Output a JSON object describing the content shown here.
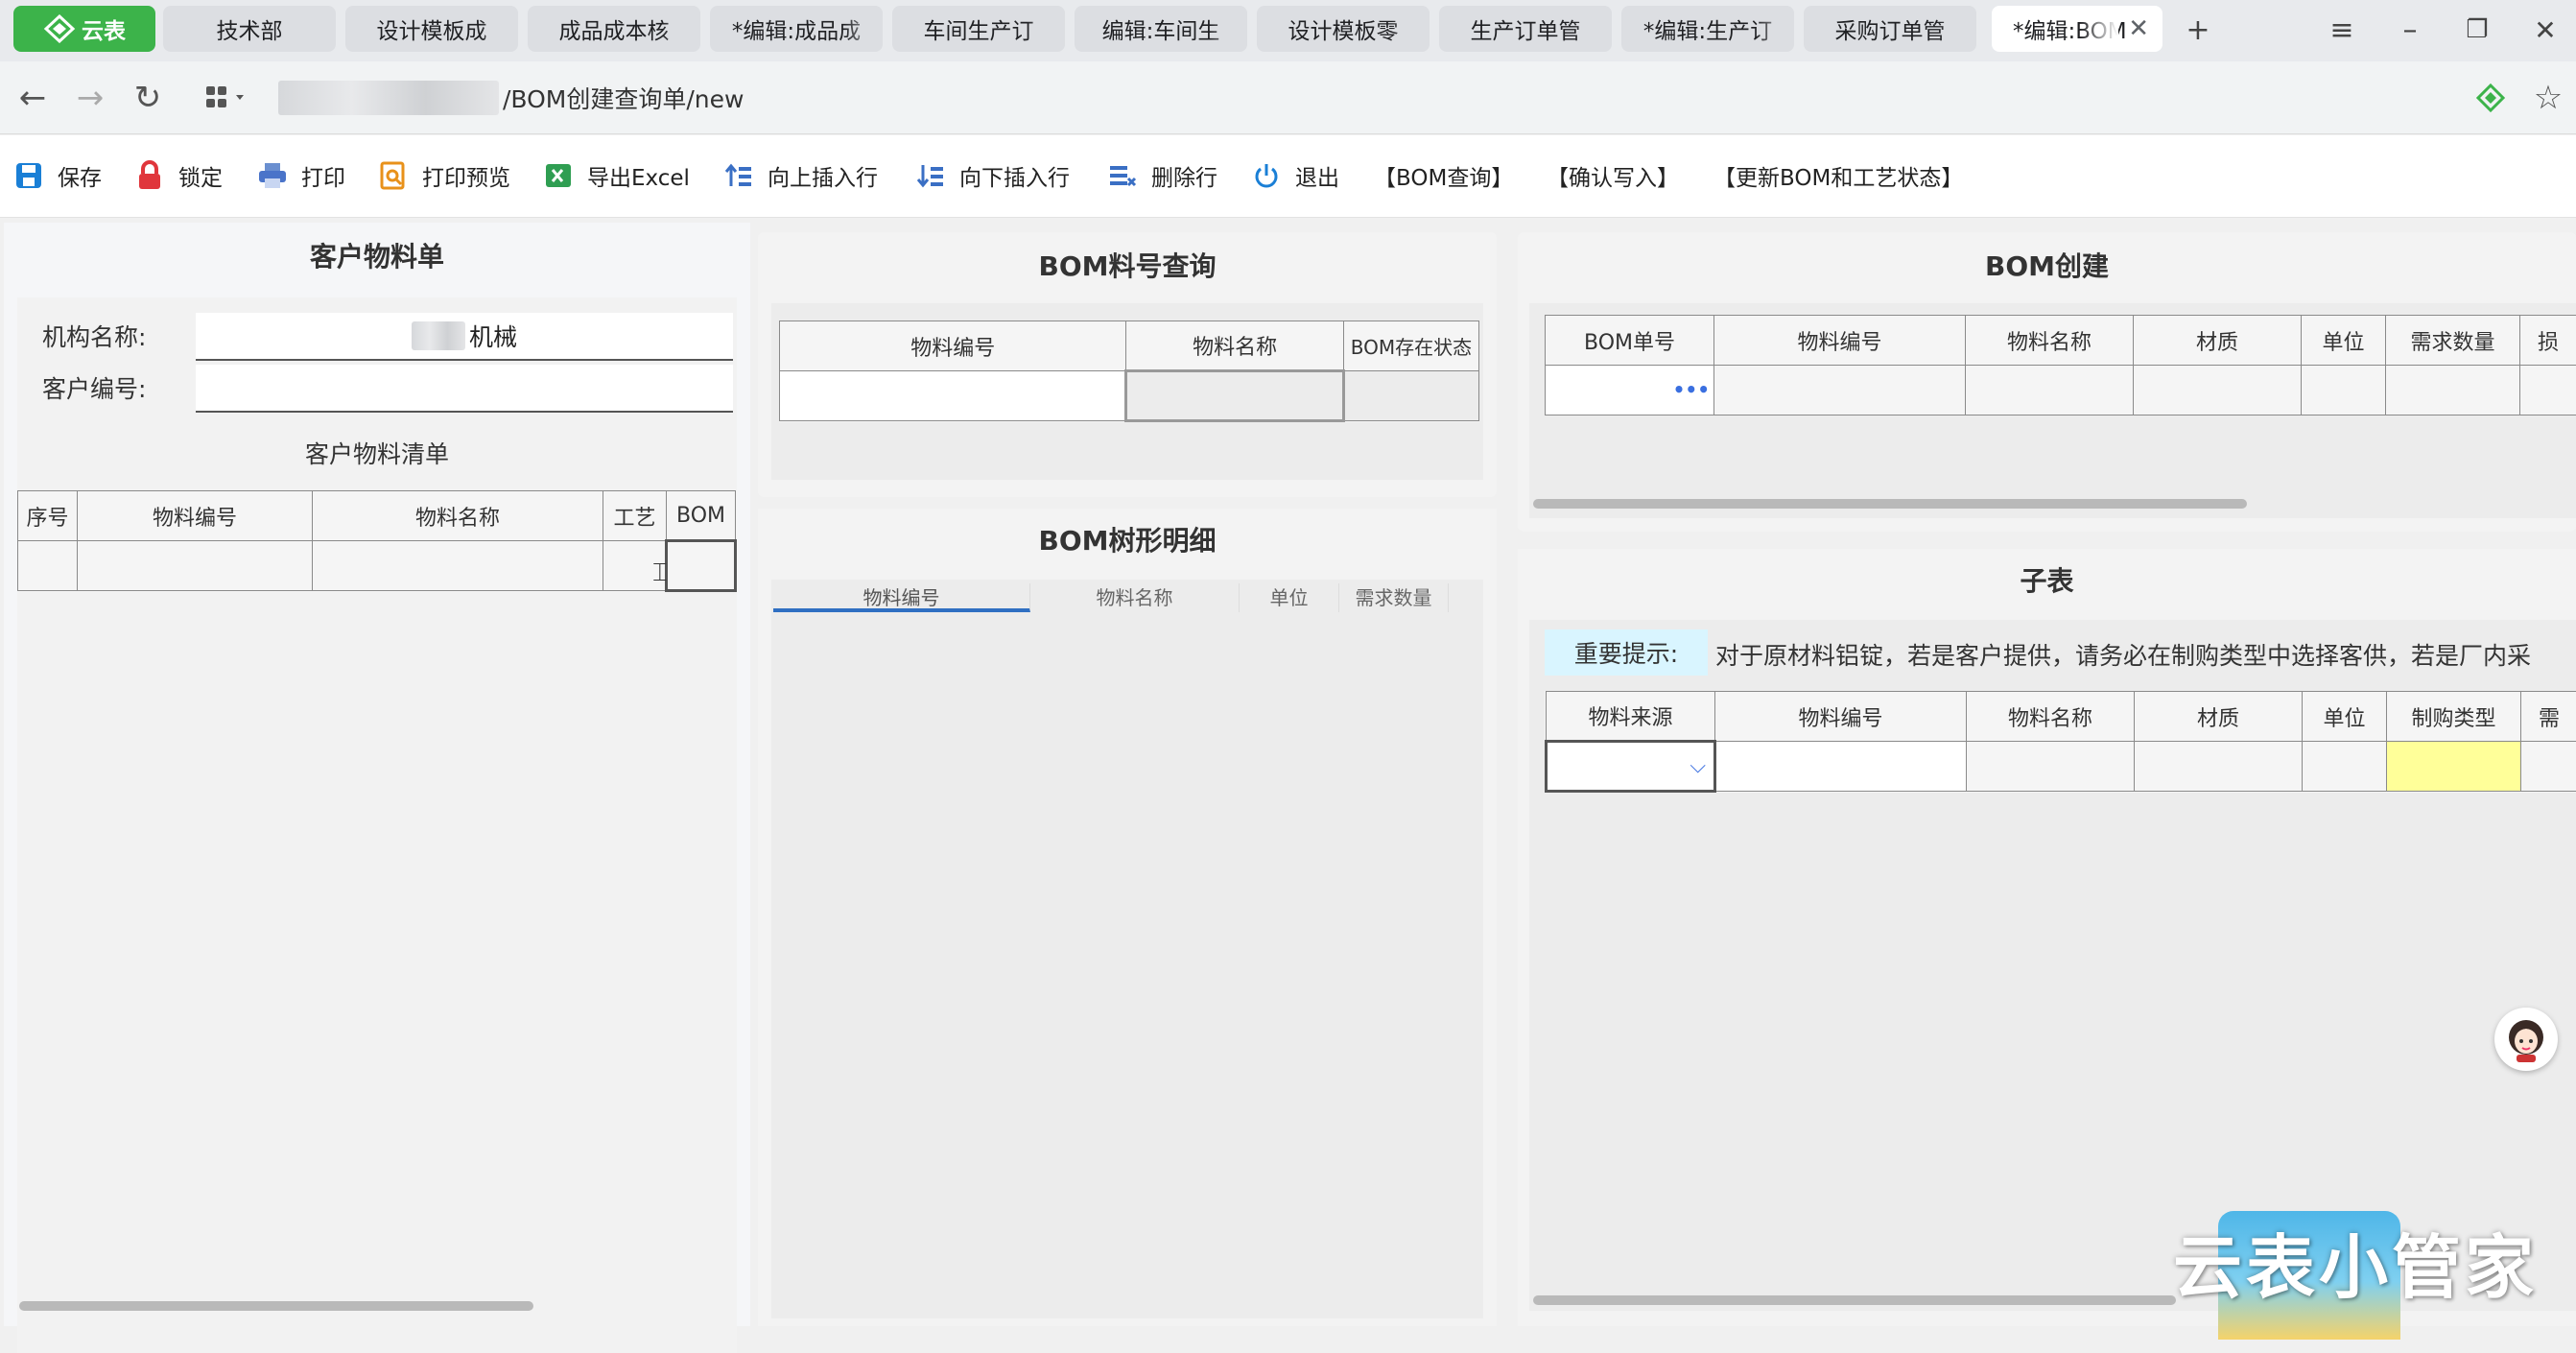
{
  "tabs": [
    {
      "label": "云表",
      "app": true
    },
    {
      "label": "技术部"
    },
    {
      "label": "设计模板成"
    },
    {
      "label": "成品成本核"
    },
    {
      "label": "*编辑:成品成"
    },
    {
      "label": "车间生产订"
    },
    {
      "label": "编辑:车间生"
    },
    {
      "label": "设计模板零"
    },
    {
      "label": "生产订单管"
    },
    {
      "label": "*编辑:生产订"
    },
    {
      "label": "采购订单管"
    },
    {
      "label": "*编辑:BOM",
      "active": true
    }
  ],
  "browser": {
    "url_suffix": "/BOM创建查询单/new"
  },
  "toolbar": [
    {
      "label": "保存",
      "icon": "save-icon"
    },
    {
      "label": "锁定",
      "icon": "lock-icon"
    },
    {
      "label": "打印",
      "icon": "print-icon"
    },
    {
      "label": "打印预览",
      "icon": "print-preview-icon"
    },
    {
      "label": "导出Excel",
      "icon": "excel-icon"
    },
    {
      "label": "向上插入行",
      "icon": "insert-above-icon"
    },
    {
      "label": "向下插入行",
      "icon": "insert-below-icon"
    },
    {
      "label": "删除行",
      "icon": "delete-row-icon"
    },
    {
      "label": "退出",
      "icon": "power-icon"
    },
    {
      "label": "【BOM查询】"
    },
    {
      "label": "【确认写入】"
    },
    {
      "label": "【更新BOM和工艺状态】"
    }
  ],
  "customer_panel": {
    "title": "客户物料单",
    "org_label": "机构名称:",
    "org_value": "机械",
    "cust_label": "客户编号:",
    "cust_value": "",
    "list_title": "客户物料清单",
    "columns": [
      "序号",
      "物料编号",
      "物料名称",
      "工艺",
      "BOM"
    ]
  },
  "bom_query": {
    "title": "BOM料号查询",
    "columns": [
      "物料编号",
      "物料名称",
      "BOM存在状态"
    ]
  },
  "bom_tree": {
    "title": "BOM树形明细",
    "columns": [
      "物料编号",
      "物料名称",
      "单位",
      "需求数量"
    ]
  },
  "bom_create": {
    "title": "BOM创建",
    "columns": [
      "BOM单号",
      "物料编号",
      "物料名称",
      "材质",
      "单位",
      "需求数量",
      "损"
    ],
    "ellipsis": "•••"
  },
  "sub_table": {
    "title": "子表",
    "notice_label": "重要提示:",
    "notice_text": "对于原材料铝锭，若是客户提供，请务必在制购类型中选择客供，若是厂内采",
    "columns": [
      "物料来源",
      "物料编号",
      "物料名称",
      "材质",
      "单位",
      "制购类型",
      "需"
    ],
    "highlight_color": "#ffff99"
  },
  "watermark": "云表小管家",
  "colors": {
    "app_green": "#3cb34a",
    "toolbar_blue": "#1a7fd6",
    "notice_bg": "#d9f5ff"
  }
}
